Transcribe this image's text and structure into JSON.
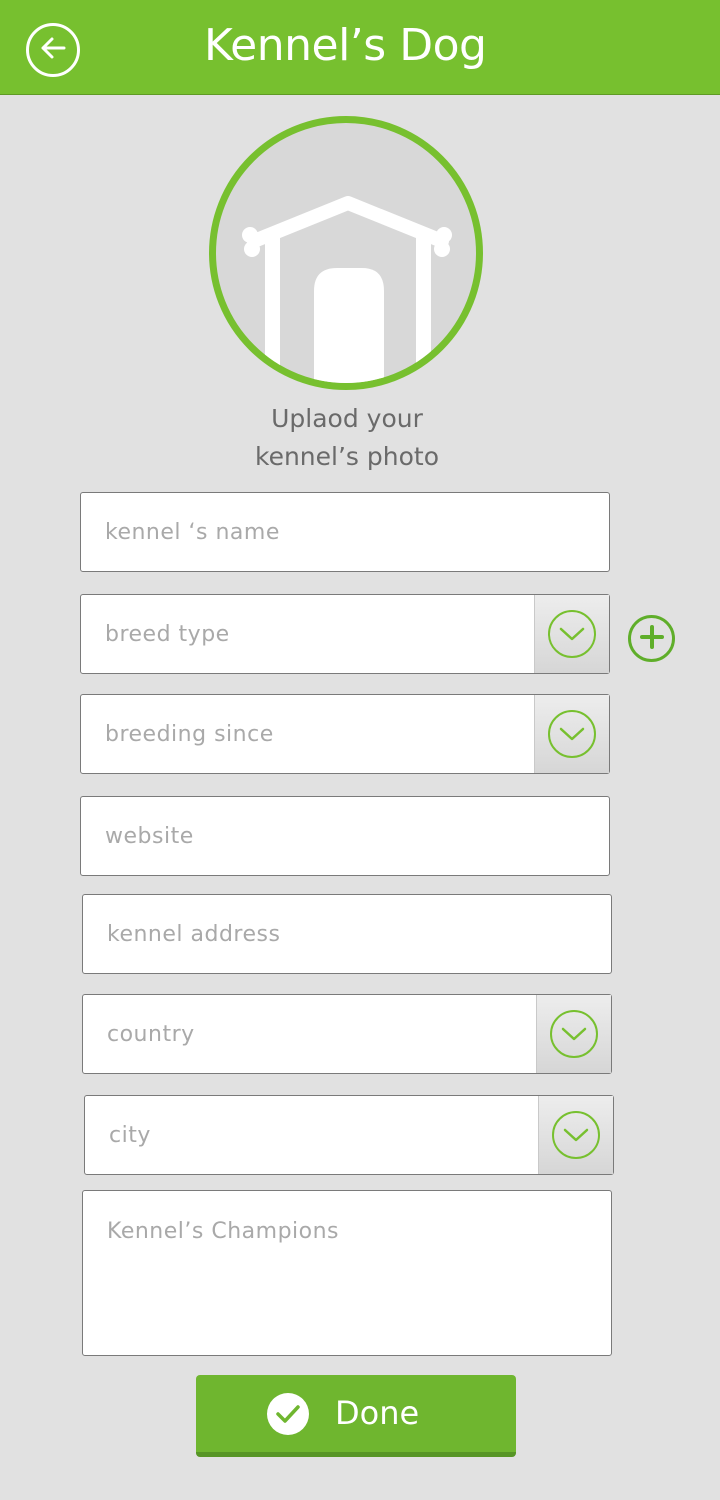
{
  "header": {
    "title": "Kennel’s Dog",
    "back_icon": "arrow-left-icon"
  },
  "photo": {
    "icon": "kennel-house-icon",
    "label_line1": "Uplaod your",
    "label_line2": "kennel’s photo"
  },
  "form": {
    "kennel_name": {
      "placeholder": "kennel ‘s name",
      "value": ""
    },
    "breed_type": {
      "placeholder": "breed type",
      "value": ""
    },
    "breeding_since": {
      "placeholder": "breeding since",
      "value": ""
    },
    "website": {
      "placeholder": "website",
      "value": ""
    },
    "kennel_address": {
      "placeholder": "kennel address",
      "value": ""
    },
    "country": {
      "placeholder": "country",
      "value": ""
    },
    "city": {
      "placeholder": "city",
      "value": ""
    },
    "champions": {
      "placeholder": "Kennel’s Champions",
      "value": ""
    }
  },
  "actions": {
    "add_breed_icon": "plus-icon",
    "done_label": "Done",
    "done_icon": "checkmark-icon"
  },
  "colors": {
    "accent": "#77c02f",
    "background": "#e1e1e1",
    "placeholder": "#a9a9a9"
  }
}
